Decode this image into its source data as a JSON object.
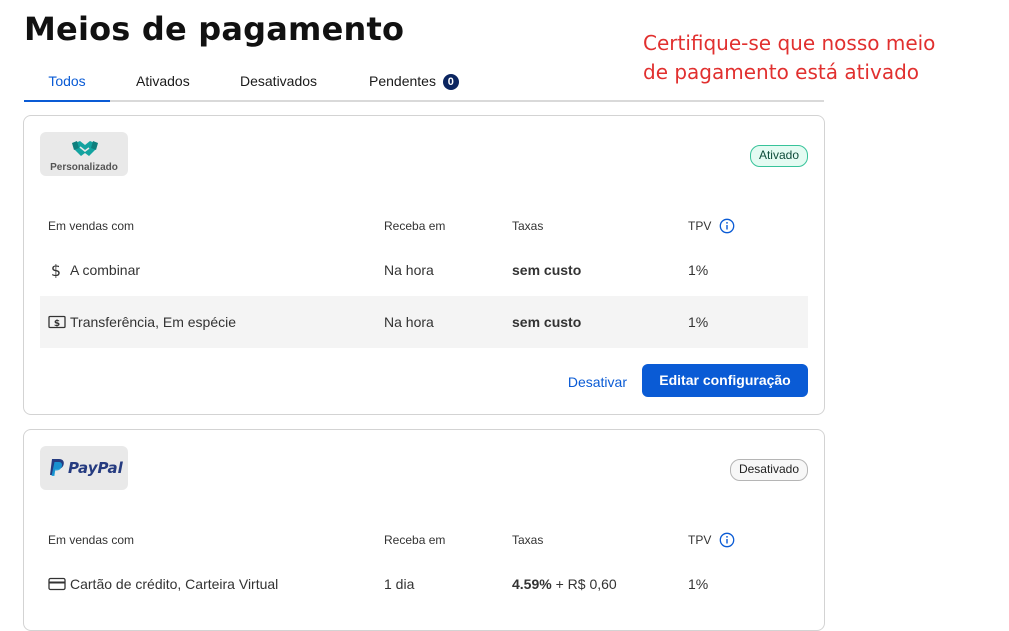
{
  "page": {
    "title": "Meios de pagamento",
    "tabs": [
      {
        "label": "Todos",
        "active": true
      },
      {
        "label": "Ativados"
      },
      {
        "label": "Desativados"
      },
      {
        "label": "Pendentes",
        "count": "0"
      }
    ]
  },
  "annotation": {
    "text": "Certifique-se que nosso meio de pagamento está ativado",
    "color": "#e1302f"
  },
  "columns": {
    "sales": "Em vendas com",
    "receive": "Receba em",
    "fees": "Taxas",
    "tpv": "TPV"
  },
  "cards": [
    {
      "logo_label": "Personalizado",
      "logo_icon": "handshake-icon",
      "status": "Ativado",
      "rows": [
        {
          "icon": "dollar-icon",
          "desc": "A combinar",
          "receive": "Na hora",
          "fee_bold": "sem custo",
          "fee_rest": "",
          "tpv": "1%"
        },
        {
          "icon": "cash-icon",
          "desc": "Transferência, Em espécie",
          "receive": "Na hora",
          "fee_bold": "sem custo",
          "fee_rest": "",
          "tpv": "1%"
        }
      ],
      "actions": {
        "secondary": "Desativar",
        "primary": "Editar configuração"
      }
    },
    {
      "logo_label": "PayPal",
      "logo_icon": "paypal-logo-icon",
      "status": "Desativado",
      "rows": [
        {
          "icon": "credit-card-icon",
          "desc": "Cartão de crédito, Carteira Virtual",
          "receive": "1 dia",
          "fee_bold": "4.59%",
          "fee_rest": " + R$ 0,60",
          "tpv": "1%"
        }
      ]
    }
  ],
  "colors": {
    "accent": "#0a5bd5",
    "active_badge_bg": "#e4fbf2",
    "active_badge_border": "#37c39a",
    "annotation": "#e1302f"
  }
}
